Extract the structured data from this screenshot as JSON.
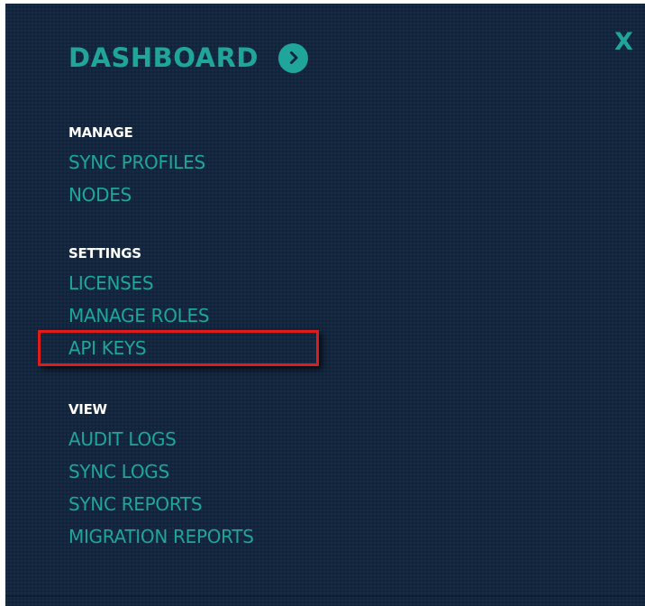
{
  "menu": {
    "title": "DASHBOARD",
    "close_label": "X",
    "sections": [
      {
        "label": "MANAGE",
        "items": [
          "SYNC PROFILES",
          "NODES"
        ]
      },
      {
        "label": "SETTINGS",
        "items": [
          "LICENSES",
          "MANAGE ROLES",
          "API KEYS"
        ]
      },
      {
        "label": "VIEW",
        "items": [
          "AUDIT LOGS",
          "SYNC LOGS",
          "SYNC REPORTS",
          "MIGRATION REPORTS"
        ]
      }
    ]
  },
  "highlighted_item": "API KEYS",
  "colors": {
    "background": "#13263f",
    "accent": "#1fa59a",
    "section_label": "#ffffff",
    "highlight_border": "#e01b1b"
  },
  "icons": {
    "chevron": "chevron-right-circle-icon"
  }
}
